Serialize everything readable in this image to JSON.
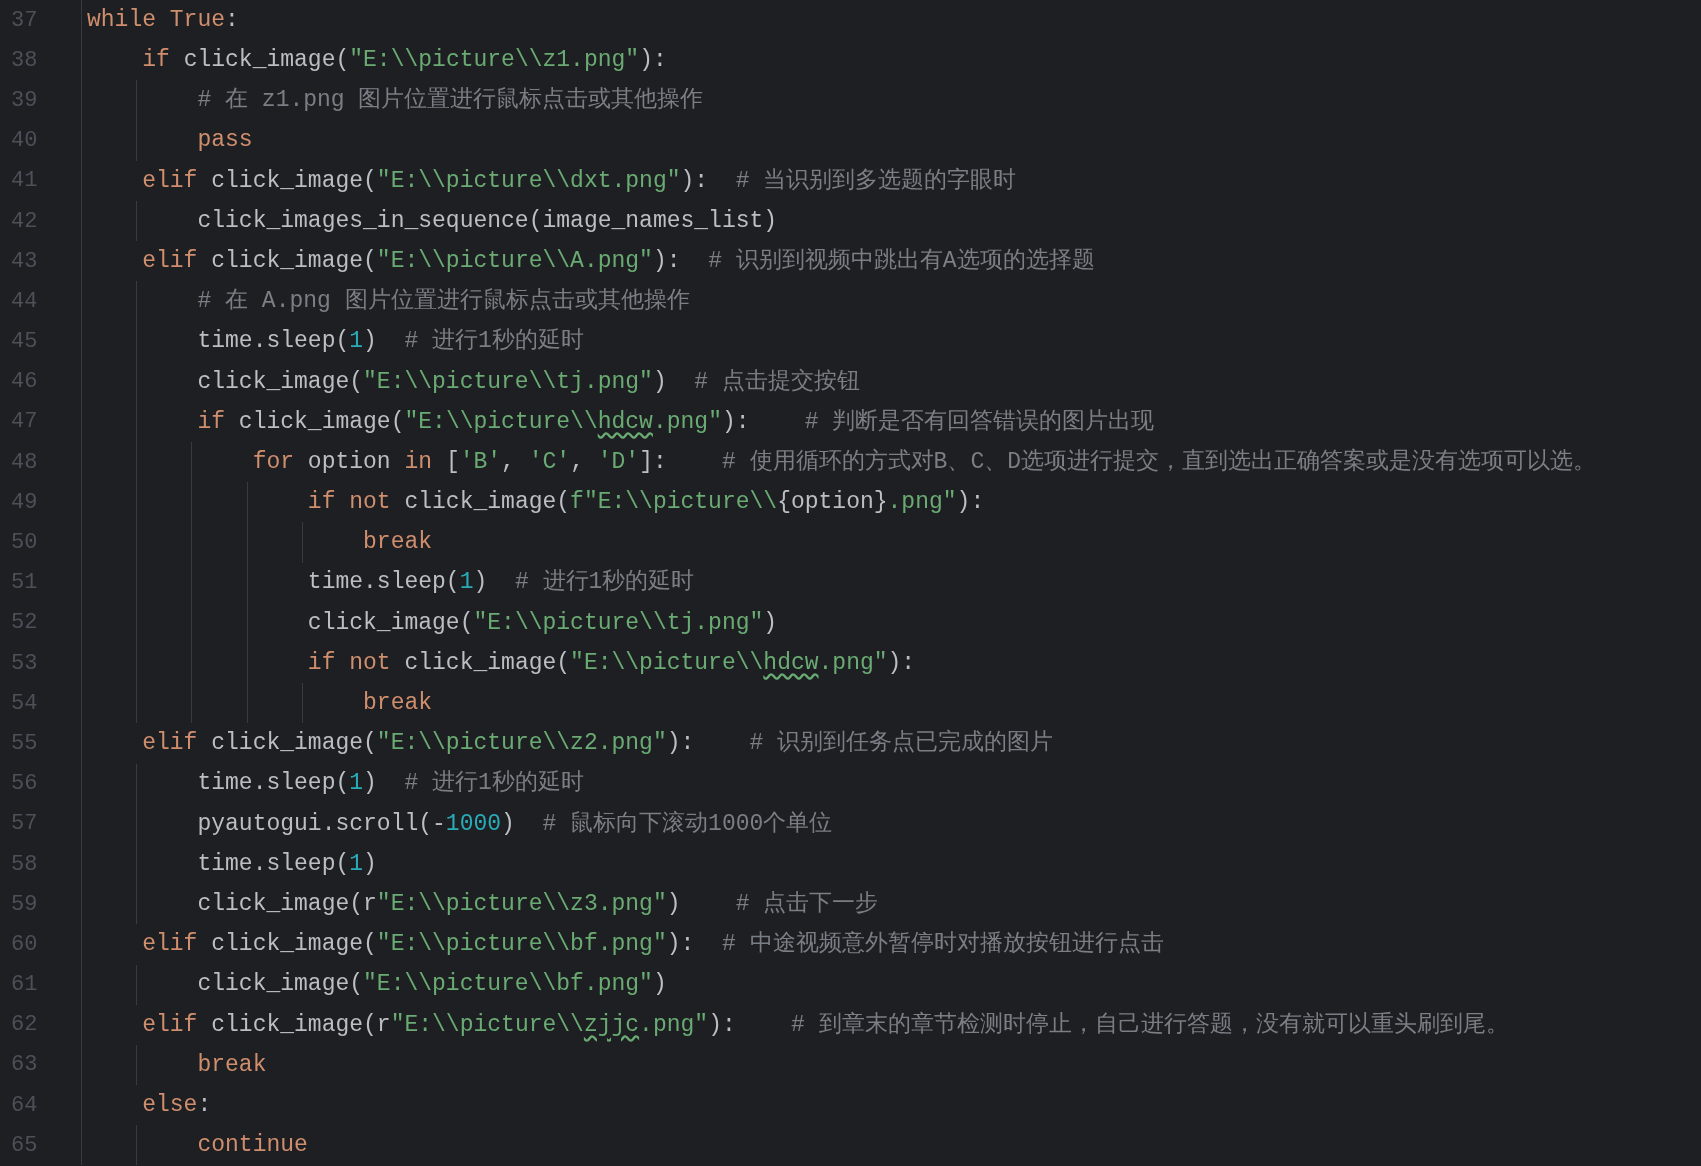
{
  "editor": {
    "lines": [
      {
        "number": "37",
        "segments": [
          {
            "kind": "keyword",
            "text": "while True"
          },
          {
            "kind": "plain",
            "text": ":"
          }
        ]
      },
      {
        "number": "38",
        "segments": [
          {
            "kind": "keyword",
            "text": "    if"
          },
          {
            "kind": "plain",
            "text": " click_image("
          },
          {
            "kind": "string",
            "text": "\"E:\\\\picture\\\\z1.png\""
          },
          {
            "kind": "plain",
            "text": "):"
          }
        ]
      },
      {
        "number": "39",
        "segments": [
          {
            "kind": "comment",
            "text": "        # 在 z1.png 图片位置进行鼠标点击或其他操作"
          }
        ]
      },
      {
        "number": "40",
        "segments": [
          {
            "kind": "keyword",
            "text": "        pass"
          }
        ]
      },
      {
        "number": "41",
        "segments": [
          {
            "kind": "keyword",
            "text": "    elif"
          },
          {
            "kind": "plain",
            "text": " click_image("
          },
          {
            "kind": "string",
            "text": "\"E:\\\\picture\\\\dxt.png\""
          },
          {
            "kind": "plain",
            "text": "):  "
          },
          {
            "kind": "comment",
            "text": "# 当识别到多选题的字眼时"
          }
        ]
      },
      {
        "number": "42",
        "segments": [
          {
            "kind": "plain",
            "text": "        click_images_in_sequence(image_names_list)"
          }
        ]
      },
      {
        "number": "43",
        "segments": [
          {
            "kind": "keyword",
            "text": "    elif"
          },
          {
            "kind": "plain",
            "text": " click_image("
          },
          {
            "kind": "string",
            "text": "\"E:\\\\picture\\\\A.png\""
          },
          {
            "kind": "plain",
            "text": "):  "
          },
          {
            "kind": "comment",
            "text": "# 识别到视频中跳出有A选项的选择题"
          }
        ]
      },
      {
        "number": "44",
        "segments": [
          {
            "kind": "comment",
            "text": "        # 在 A.png 图片位置进行鼠标点击或其他操作"
          }
        ]
      },
      {
        "number": "45",
        "segments": [
          {
            "kind": "plain",
            "text": "        time.sleep("
          },
          {
            "kind": "number",
            "text": "1"
          },
          {
            "kind": "plain",
            "text": ")  "
          },
          {
            "kind": "comment",
            "text": "# 进行1秒的延时"
          }
        ]
      },
      {
        "number": "46",
        "segments": [
          {
            "kind": "plain",
            "text": "        click_image("
          },
          {
            "kind": "string",
            "text": "\"E:\\\\picture\\\\tj.png\""
          },
          {
            "kind": "plain",
            "text": ")  "
          },
          {
            "kind": "comment",
            "text": "# 点击提交按钮"
          }
        ]
      },
      {
        "number": "47",
        "segments": [
          {
            "kind": "keyword",
            "text": "        if"
          },
          {
            "kind": "plain",
            "text": " click_image("
          },
          {
            "kind": "string",
            "text": "\"E:\\\\picture\\\\"
          },
          {
            "kind": "string_typo",
            "text": "hdcw"
          },
          {
            "kind": "string",
            "text": ".png\""
          },
          {
            "kind": "plain",
            "text": "):    "
          },
          {
            "kind": "comment",
            "text": "# 判断是否有回答错误的图片出现"
          }
        ]
      },
      {
        "number": "48",
        "segments": [
          {
            "kind": "keyword",
            "text": "            for"
          },
          {
            "kind": "plain",
            "text": " option "
          },
          {
            "kind": "keyword",
            "text": "in"
          },
          {
            "kind": "plain",
            "text": " ["
          },
          {
            "kind": "string",
            "text": "'B'"
          },
          {
            "kind": "plain",
            "text": ", "
          },
          {
            "kind": "string",
            "text": "'C'"
          },
          {
            "kind": "plain",
            "text": ", "
          },
          {
            "kind": "string",
            "text": "'D'"
          },
          {
            "kind": "plain",
            "text": "]:    "
          },
          {
            "kind": "comment",
            "text": "# 使用循环的方式对B、C、D选项进行提交，直到选出正确答案或是没有选项可以选。"
          }
        ]
      },
      {
        "number": "49",
        "segments": [
          {
            "kind": "keyword",
            "text": "                if not"
          },
          {
            "kind": "plain",
            "text": " click_image("
          },
          {
            "kind": "string",
            "text": "f\"E:\\\\picture\\\\"
          },
          {
            "kind": "plain",
            "text": "{option}"
          },
          {
            "kind": "string",
            "text": ".png\""
          },
          {
            "kind": "plain",
            "text": "):"
          }
        ]
      },
      {
        "number": "50",
        "segments": [
          {
            "kind": "keyword",
            "text": "                    break"
          }
        ]
      },
      {
        "number": "51",
        "segments": [
          {
            "kind": "plain",
            "text": "                time.sleep("
          },
          {
            "kind": "number",
            "text": "1"
          },
          {
            "kind": "plain",
            "text": ")  "
          },
          {
            "kind": "comment",
            "text": "# 进行1秒的延时"
          }
        ]
      },
      {
        "number": "52",
        "segments": [
          {
            "kind": "plain",
            "text": "                click_image("
          },
          {
            "kind": "string",
            "text": "\"E:\\\\picture\\\\tj.png\""
          },
          {
            "kind": "plain",
            "text": ")"
          }
        ]
      },
      {
        "number": "53",
        "segments": [
          {
            "kind": "keyword",
            "text": "                if not"
          },
          {
            "kind": "plain",
            "text": " click_image("
          },
          {
            "kind": "string",
            "text": "\"E:\\\\picture\\\\"
          },
          {
            "kind": "string_typo",
            "text": "hdcw"
          },
          {
            "kind": "string",
            "text": ".png\""
          },
          {
            "kind": "plain",
            "text": "):"
          }
        ]
      },
      {
        "number": "54",
        "segments": [
          {
            "kind": "keyword",
            "text": "                    break"
          }
        ]
      },
      {
        "number": "55",
        "segments": [
          {
            "kind": "keyword",
            "text": "    elif"
          },
          {
            "kind": "plain",
            "text": " click_image("
          },
          {
            "kind": "string",
            "text": "\"E:\\\\picture\\\\z2.png\""
          },
          {
            "kind": "plain",
            "text": "):    "
          },
          {
            "kind": "comment",
            "text": "# 识别到任务点已完成的图片"
          }
        ]
      },
      {
        "number": "56",
        "segments": [
          {
            "kind": "plain",
            "text": "        time.sleep("
          },
          {
            "kind": "number",
            "text": "1"
          },
          {
            "kind": "plain",
            "text": ")  "
          },
          {
            "kind": "comment",
            "text": "# 进行1秒的延时"
          }
        ]
      },
      {
        "number": "57",
        "segments": [
          {
            "kind": "plain",
            "text": "        pyautogui.scroll(-"
          },
          {
            "kind": "number",
            "text": "1000"
          },
          {
            "kind": "plain",
            "text": ")  "
          },
          {
            "kind": "comment",
            "text": "# 鼠标向下滚动1000个单位"
          }
        ]
      },
      {
        "number": "58",
        "segments": [
          {
            "kind": "plain",
            "text": "        time.sleep("
          },
          {
            "kind": "number",
            "text": "1"
          },
          {
            "kind": "plain",
            "text": ")"
          }
        ]
      },
      {
        "number": "59",
        "segments": [
          {
            "kind": "plain",
            "text": "        click_image(r"
          },
          {
            "kind": "string",
            "text": "\"E:\\\\picture\\\\z3.png\""
          },
          {
            "kind": "plain",
            "text": ")    "
          },
          {
            "kind": "comment",
            "text": "# 点击下一步"
          }
        ]
      },
      {
        "number": "60",
        "segments": [
          {
            "kind": "keyword",
            "text": "    elif"
          },
          {
            "kind": "plain",
            "text": " click_image("
          },
          {
            "kind": "string",
            "text": "\"E:\\\\picture\\\\bf.png\""
          },
          {
            "kind": "plain",
            "text": "):  "
          },
          {
            "kind": "comment",
            "text": "# 中途视频意外暂停时对播放按钮进行点击"
          }
        ]
      },
      {
        "number": "61",
        "segments": [
          {
            "kind": "plain",
            "text": "        click_image("
          },
          {
            "kind": "string",
            "text": "\"E:\\\\picture\\\\bf.png\""
          },
          {
            "kind": "plain",
            "text": ")"
          }
        ]
      },
      {
        "number": "62",
        "segments": [
          {
            "kind": "keyword",
            "text": "    elif"
          },
          {
            "kind": "plain",
            "text": " click_image(r"
          },
          {
            "kind": "string",
            "text": "\"E:\\\\picture\\\\"
          },
          {
            "kind": "string_typo",
            "text": "zjjc"
          },
          {
            "kind": "string",
            "text": ".png\""
          },
          {
            "kind": "plain",
            "text": "):    "
          },
          {
            "kind": "comment",
            "text": "# 到章末的章节检测时停止，自己进行答题，没有就可以重头刷到尾。"
          }
        ]
      },
      {
        "number": "63",
        "segments": [
          {
            "kind": "keyword",
            "text": "        break"
          }
        ]
      },
      {
        "number": "64",
        "segments": [
          {
            "kind": "keyword",
            "text": "    else"
          },
          {
            "kind": "plain",
            "text": ":"
          }
        ]
      },
      {
        "number": "65",
        "segments": [
          {
            "kind": "keyword",
            "text": "        continue"
          }
        ]
      }
    ]
  }
}
